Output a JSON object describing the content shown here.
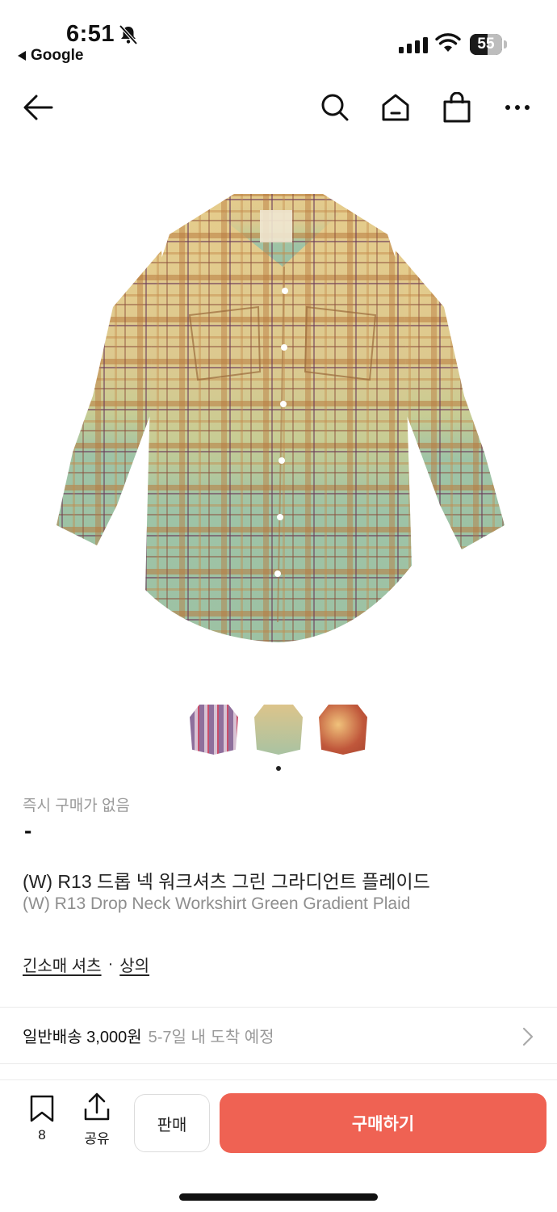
{
  "status_bar": {
    "time": "6:51",
    "back_app": "Google",
    "battery": "55",
    "battery_level": 0.55
  },
  "nav": {
    "icons": [
      "back-arrow-icon",
      "search-icon",
      "home-icon",
      "shopping-bag-icon",
      "more-icon"
    ]
  },
  "product": {
    "image_count": 3,
    "active_image": 1,
    "availability": "즉시 구매가 없음",
    "price": "-",
    "title_ko": "(W) R13 드롭 넥 워크셔츠 그린 그라디언트 플레이드",
    "title_en": "(W) R13 Drop Neck Workshirt Green Gradient Plaid",
    "category_sub": "긴소매 셔츠",
    "category_separator": "·",
    "category_main": "상의"
  },
  "shipping": {
    "type": "일반배송 3,000원",
    "eta": "5-7일 내 도착 예정"
  },
  "bottom_bar": {
    "bookmark_count": "8",
    "share_label": "공유",
    "sell_label": "판매",
    "buy_label": "구매하기"
  },
  "colors": {
    "buy_button": "#ef6253",
    "text": "#111111",
    "muted": "#9a9a9a"
  }
}
